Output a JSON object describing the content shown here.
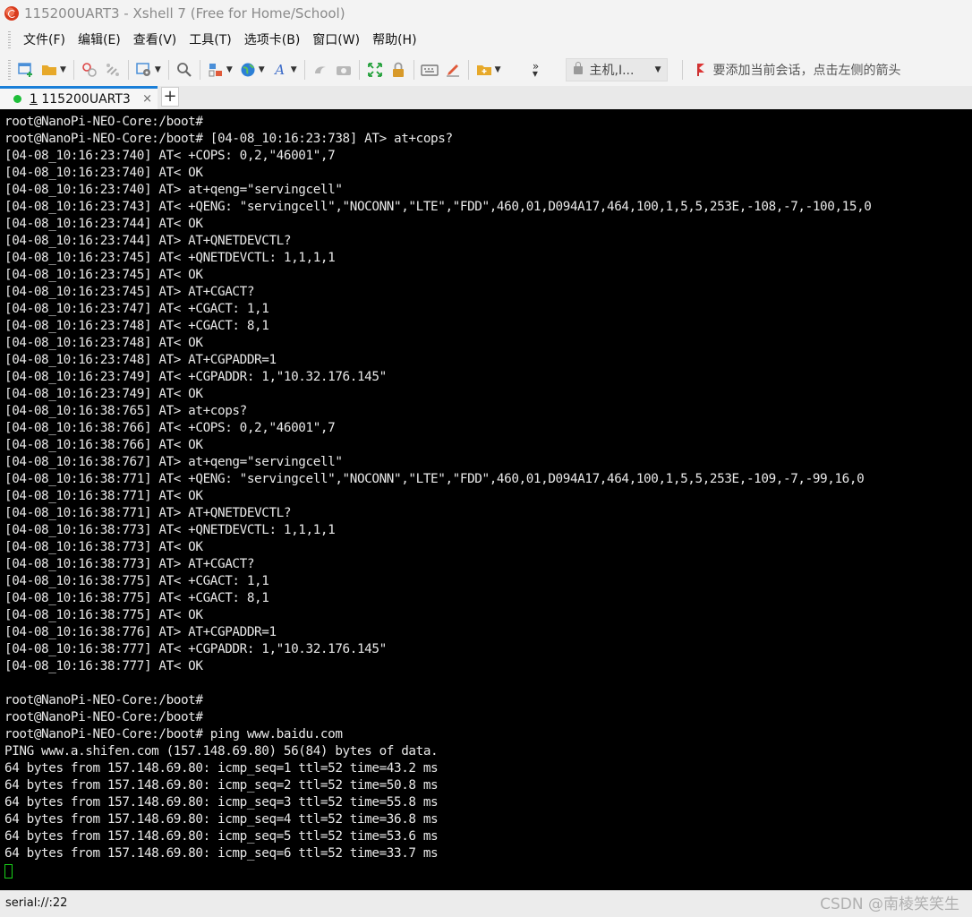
{
  "window": {
    "title": "115200UART3 - Xshell 7 (Free for Home/School)"
  },
  "menu": {
    "items": [
      "文件(F)",
      "编辑(E)",
      "查看(V)",
      "工具(T)",
      "选项卡(B)",
      "窗口(W)",
      "帮助(H)"
    ]
  },
  "toolbar": {
    "icons": [
      "new-session-icon",
      "open-folder-icon",
      "disconnect-icon",
      "reconnect-icon",
      "properties-icon",
      "find-icon",
      "transfer-icon",
      "globe-icon",
      "font-icon",
      "xftp-icon",
      "screenshot-icon",
      "fullscreen-icon",
      "lock-icon",
      "keyboard-icon",
      "highlight-icon",
      "add-session-icon",
      "more-icon"
    ],
    "host_placeholder": "主机,I...",
    "tip": "要添加当前会话，点击左侧的箭头"
  },
  "tabs": {
    "active": {
      "number": "1",
      "name": " 115200UART3"
    },
    "close_glyph": "×",
    "add_glyph": "+"
  },
  "terminal": {
    "lines": [
      "root@NanoPi-NEO-Core:/boot#",
      "root@NanoPi-NEO-Core:/boot# [04-08_10:16:23:738] AT> at+cops?",
      "[04-08_10:16:23:740] AT< +COPS: 0,2,\"46001\",7",
      "[04-08_10:16:23:740] AT< OK",
      "[04-08_10:16:23:740] AT> at+qeng=\"servingcell\"",
      "[04-08_10:16:23:743] AT< +QENG: \"servingcell\",\"NOCONN\",\"LTE\",\"FDD\",460,01,D094A17,464,100,1,5,5,253E,-108,-7,-100,15,0",
      "[04-08_10:16:23:744] AT< OK",
      "[04-08_10:16:23:744] AT> AT+QNETDEVCTL?",
      "[04-08_10:16:23:745] AT< +QNETDEVCTL: 1,1,1,1",
      "[04-08_10:16:23:745] AT< OK",
      "[04-08_10:16:23:745] AT> AT+CGACT?",
      "[04-08_10:16:23:747] AT< +CGACT: 1,1",
      "[04-08_10:16:23:748] AT< +CGACT: 8,1",
      "[04-08_10:16:23:748] AT< OK",
      "[04-08_10:16:23:748] AT> AT+CGPADDR=1",
      "[04-08_10:16:23:749] AT< +CGPADDR: 1,\"10.32.176.145\"",
      "[04-08_10:16:23:749] AT< OK",
      "[04-08_10:16:38:765] AT> at+cops?",
      "[04-08_10:16:38:766] AT< +COPS: 0,2,\"46001\",7",
      "[04-08_10:16:38:766] AT< OK",
      "[04-08_10:16:38:767] AT> at+qeng=\"servingcell\"",
      "[04-08_10:16:38:771] AT< +QENG: \"servingcell\",\"NOCONN\",\"LTE\",\"FDD\",460,01,D094A17,464,100,1,5,5,253E,-109,-7,-99,16,0",
      "[04-08_10:16:38:771] AT< OK",
      "[04-08_10:16:38:771] AT> AT+QNETDEVCTL?",
      "[04-08_10:16:38:773] AT< +QNETDEVCTL: 1,1,1,1",
      "[04-08_10:16:38:773] AT< OK",
      "[04-08_10:16:38:773] AT> AT+CGACT?",
      "[04-08_10:16:38:775] AT< +CGACT: 1,1",
      "[04-08_10:16:38:775] AT< +CGACT: 8,1",
      "[04-08_10:16:38:775] AT< OK",
      "[04-08_10:16:38:776] AT> AT+CGPADDR=1",
      "[04-08_10:16:38:777] AT< +CGPADDR: 1,\"10.32.176.145\"",
      "[04-08_10:16:38:777] AT< OK",
      "",
      "root@NanoPi-NEO-Core:/boot#",
      "root@NanoPi-NEO-Core:/boot#",
      "root@NanoPi-NEO-Core:/boot# ping www.baidu.com",
      "PING www.a.shifen.com (157.148.69.80) 56(84) bytes of data.",
      "64 bytes from 157.148.69.80: icmp_seq=1 ttl=52 time=43.2 ms",
      "64 bytes from 157.148.69.80: icmp_seq=2 ttl=52 time=50.8 ms",
      "64 bytes from 157.148.69.80: icmp_seq=3 ttl=52 time=55.8 ms",
      "64 bytes from 157.148.69.80: icmp_seq=4 ttl=52 time=36.8 ms",
      "64 bytes from 157.148.69.80: icmp_seq=5 ttl=52 time=53.6 ms",
      "64 bytes from 157.148.69.80: icmp_seq=6 ttl=52 time=33.7 ms"
    ],
    "colors": {
      "background": "#000000",
      "foreground": "#e8e8e8",
      "cursor": "#19d219"
    }
  },
  "status": {
    "connection": "serial://:22",
    "watermark": "CSDN @南棱笑笑生"
  },
  "colors": {
    "tab_accent": "#1a7fd8",
    "tab_status_dot": "#1fbf3a"
  }
}
